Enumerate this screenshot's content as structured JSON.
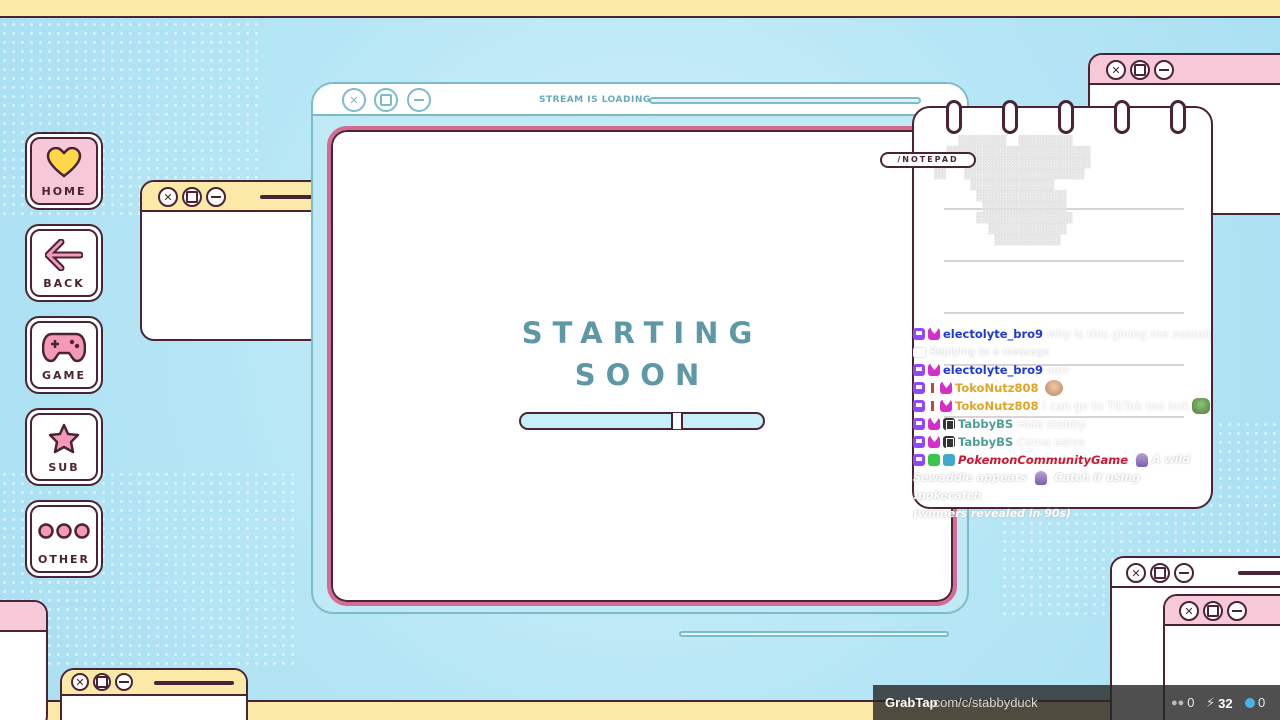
{
  "colors": {
    "outline": "#4a2436",
    "pink": "#f7c9d8",
    "yellow": "#fbe9a7",
    "accent_pink": "#d36b92",
    "teal_text": "#5e97a5",
    "sky": "#b6e6f5"
  },
  "sidebar": {
    "items": [
      {
        "label": "HOME",
        "icon": "heart-icon",
        "active": true
      },
      {
        "label": "BACK",
        "icon": "arrow-left-icon",
        "active": false
      },
      {
        "label": "GAME",
        "icon": "gamepad-icon",
        "active": false
      },
      {
        "label": "SUB",
        "icon": "star-icon",
        "active": false
      },
      {
        "label": "OTHER",
        "icon": "more-dots-icon",
        "active": false
      }
    ]
  },
  "window_controls": {
    "close_glyph": "✕"
  },
  "main": {
    "loading_label": "STREAM IS LOADING",
    "title_line1": "STARTING",
    "title_line2": "SOON",
    "progress_fraction": 0.65
  },
  "notepad": {
    "label": "/NOTEPAD"
  },
  "chat": {
    "messages": [
      {
        "user": "electolyte_bro9",
        "user_color": "#1d3ad6",
        "badges": [
          "tw",
          "heart"
        ],
        "text": "why is this giving me nostalgia"
      },
      {
        "reply": "Replying to a message"
      },
      {
        "user": "electolyte_bro9",
        "user_color": "#1d3ad6",
        "badges": [
          "tw",
          "heart"
        ],
        "text": "sorr"
      },
      {
        "user": "TokoNutz808",
        "user_color": "#e0a526",
        "badges": [
          "tw",
          "sword",
          "heart"
        ],
        "text": "",
        "emote": "face"
      },
      {
        "user": "TokoNutz808",
        "user_color": "#e0a526",
        "badges": [
          "tw",
          "sword",
          "heart"
        ],
        "text": "I can go to TikTok too lmk",
        "emote": "frog"
      },
      {
        "user": "TabbyBS",
        "user_color": "#4f9e96",
        "badges": [
          "tw",
          "heart",
          "bw"
        ],
        "text": "Hola stabby"
      },
      {
        "user": "TabbyBS",
        "user_color": "#4f9e96",
        "badges": [
          "tw",
          "heart",
          "bw"
        ],
        "text": "Como estas"
      },
      {
        "user": "PokemonCommunityGame",
        "user_color": "#d1142f",
        "badges": [
          "tw",
          "green",
          "cyan"
        ],
        "text": "A wild"
      }
    ],
    "game_continuation": [
      "Sewaddle appears",
      "Catch it using !pokecatch",
      "(winners revealed in 90s)"
    ]
  },
  "status_bar": {
    "brand": "GrabTap",
    "url": ".com/c/stabbyduck",
    "viewers": "0",
    "bolts": "32",
    "points": "0"
  }
}
